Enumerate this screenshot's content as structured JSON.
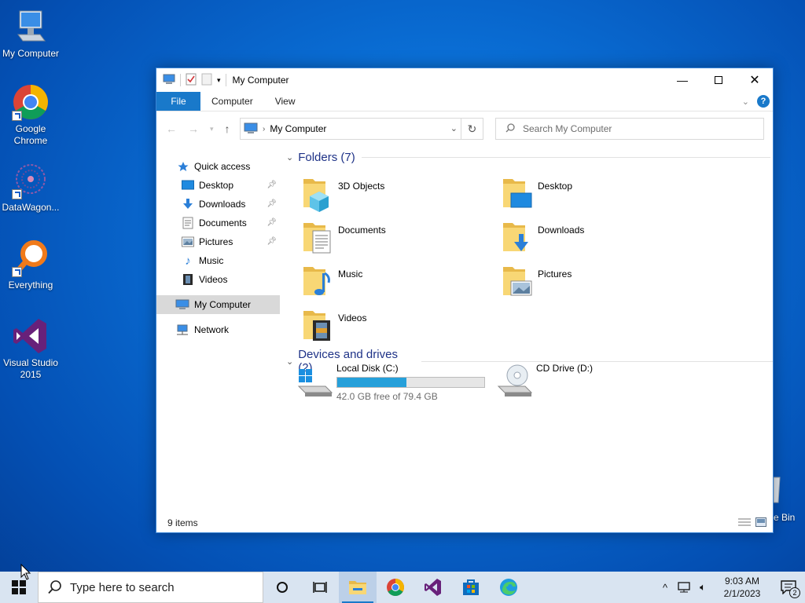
{
  "desktop": {
    "icons": [
      {
        "label": "My Computer"
      },
      {
        "label": "Google Chrome"
      },
      {
        "label": "DataWagon..."
      },
      {
        "label": "Everything"
      },
      {
        "label": "Visual Studio 2015"
      }
    ],
    "recycle_bin_partial": "e Bin"
  },
  "window": {
    "title": "My Computer",
    "ribbon_tabs": [
      "File",
      "Computer",
      "View"
    ],
    "address": "My Computer",
    "search_placeholder": "Search My Computer",
    "nav": {
      "quick_access": "Quick access",
      "pinned": [
        {
          "label": "Desktop",
          "pinned": true
        },
        {
          "label": "Downloads",
          "pinned": true
        },
        {
          "label": "Documents",
          "pinned": true
        },
        {
          "label": "Pictures",
          "pinned": true
        },
        {
          "label": "Music",
          "pinned": false
        },
        {
          "label": "Videos",
          "pinned": false
        }
      ],
      "this_pc": "My Computer",
      "network": "Network"
    },
    "folders_header": "Folders (7)",
    "folders": [
      "3D Objects",
      "Desktop",
      "Documents",
      "Downloads",
      "Music",
      "Pictures",
      "Videos"
    ],
    "devices_header": "Devices and drives (2)",
    "drives": [
      {
        "name": "Local Disk (C:)",
        "free_text": "42.0 GB free of 79.4 GB",
        "used_fraction": 0.47
      },
      {
        "name": "CD Drive (D:)"
      }
    ],
    "status": "9 items"
  },
  "taskbar": {
    "search_placeholder": "Type here to search",
    "time": "9:03 AM",
    "date": "2/1/2023",
    "notification_count": "2"
  },
  "colors": {
    "accent": "#1979ca",
    "drive_bar": "#26a0da",
    "group_header": "#1e3287"
  }
}
